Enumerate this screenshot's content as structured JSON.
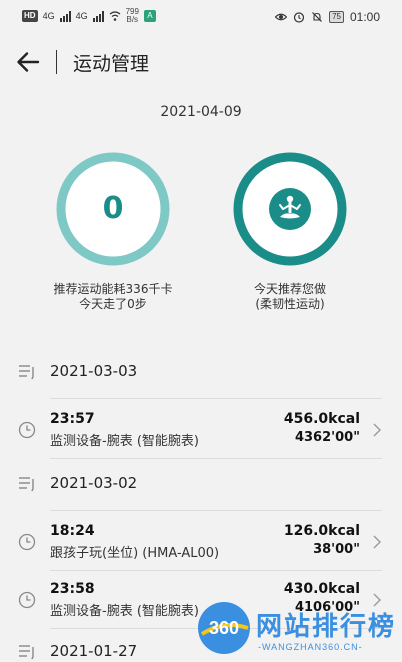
{
  "status_bar": {
    "chip": "HD",
    "net1": "4G",
    "net2": "4G",
    "speed_value": "799",
    "speed_unit": "B/s",
    "app_badge": "A",
    "battery": "75",
    "time": "01:00",
    "icons": [
      "eye-icon",
      "alarm-icon",
      "bell-off-icon",
      "battery-icon"
    ]
  },
  "header": {
    "title": "运动管理",
    "back_icon": "arrow-left-icon"
  },
  "summary": {
    "date": "2021-04-09",
    "steps_count": "0",
    "left_caption_line1": "推荐运动能耗336千卡",
    "left_caption_line2": "今天走了0步",
    "right_caption_line1": "今天推荐您做",
    "right_caption_line2": "(柔韧性运动)",
    "ring_color": "#1a8d88",
    "ring_track_color": "#7ec8c5"
  },
  "list": {
    "groups": [
      {
        "date": "2021-03-03",
        "records": [
          {
            "time": "23:57",
            "device": "监测设备-腕表 (智能腕表)",
            "kcal": "456.0kcal",
            "duration": "4362'00\""
          }
        ]
      },
      {
        "date": "2021-03-02",
        "records": [
          {
            "time": "18:24",
            "device": "跟孩子玩(坐位) (HMA-AL00)",
            "kcal": "126.0kcal",
            "duration": "38'00\""
          },
          {
            "time": "23:58",
            "device": "监测设备-腕表 (智能腕表)",
            "kcal": "430.0kcal",
            "duration": "4106'00\""
          }
        ]
      },
      {
        "date": "2021-01-27",
        "records": []
      }
    ]
  },
  "watermark": {
    "logo_text": "360",
    "cn": "网站排行榜",
    "en": "-WANGZHAN360.CN-"
  }
}
